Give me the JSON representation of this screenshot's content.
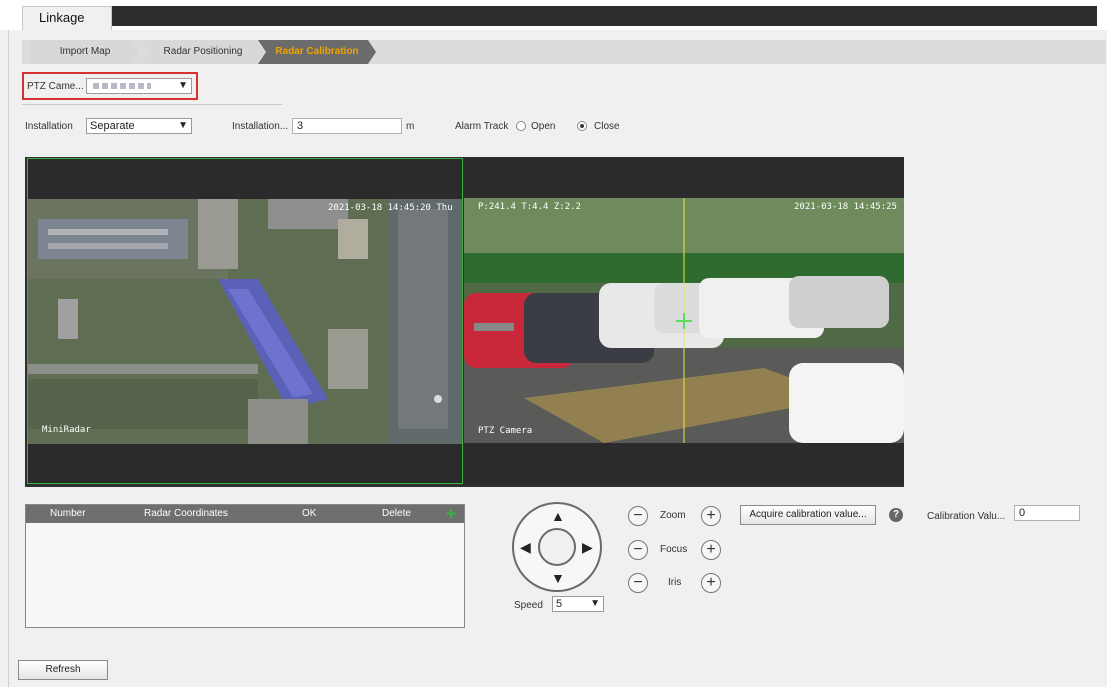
{
  "main_tab": "Linkage",
  "sub_tabs": [
    "Import Map",
    "Radar Positioning",
    "Radar Calibration"
  ],
  "ptz_camera": {
    "label": "PTZ Came...",
    "value": ""
  },
  "installation_mode": {
    "label": "Installation",
    "value": "Separate"
  },
  "installation_height": {
    "label": "Installation...",
    "value": "3",
    "unit": "m"
  },
  "alarm_track": {
    "label": "Alarm Track",
    "open_label": "Open",
    "close_label": "Close",
    "selected": "Close"
  },
  "left_view": {
    "timestamp": "2021-03-18 14:45:20 Thu",
    "caption": "MiniRadar"
  },
  "right_view": {
    "ptz_info": "P:241.4 T:4.4 Z:2.2",
    "timestamp": "2021-03-18 14:45:25",
    "caption": "PTZ Camera"
  },
  "table": {
    "headers": [
      "Number",
      "Radar Coordinates",
      "OK",
      "Delete"
    ]
  },
  "ptz_controls": {
    "zoom": "Zoom",
    "focus": "Focus",
    "iris": "Iris",
    "speed_label": "Speed",
    "speed_value": "5"
  },
  "acquire_button": "Acquire calibration value...",
  "calibration_value": {
    "label": "Calibration Valu...",
    "value": "0"
  },
  "refresh_button": "Refresh",
  "colors": {
    "active_tab_text": "#f0a300",
    "highlight_border": "#d63030",
    "selected_view_border": "#3cb043"
  }
}
